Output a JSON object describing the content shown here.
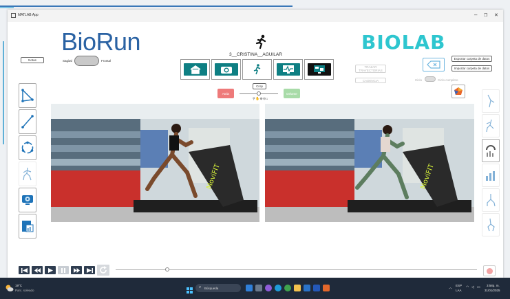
{
  "window": {
    "title": "MATLAB App",
    "controls": [
      "–",
      "❐",
      "✕"
    ]
  },
  "header": {
    "logo_left": "BioRun",
    "logo_right": "BIOLAB",
    "subject_name": "3__CRISTINA__AGUILAR",
    "notes_button": "Notas",
    "view_toggle": {
      "left_label": "Sagital",
      "right_label": "Frontal"
    }
  },
  "nav_icons": [
    {
      "name": "home-icon"
    },
    {
      "name": "camera-icon"
    },
    {
      "name": "runner-icon"
    },
    {
      "name": "monitor-chart-icon"
    },
    {
      "name": "monitor-report-icon"
    }
  ],
  "playback_side": {
    "left_button": "Atrás",
    "right_button": "Delante",
    "crop_label": "Crop"
  },
  "right_panel": {
    "trazar_trayectorias": "TRAZAR TRAYECTORIAS",
    "cadencia": "CADENCIA",
    "exportar": "Exportar carpeta de datos",
    "importar": "Importar carpeta de datos",
    "ciclo_label": "Ciclo",
    "ciclo_completo": "Ciclo completo"
  },
  "taskbar": {
    "weather_temp": "19°C",
    "weather_desc": "Parc. soleado",
    "search_placeholder": "Búsqueda",
    "lang": "ESP",
    "lang_sub": "LAA",
    "time": "3:58p. m.",
    "date": "31/01/2025"
  },
  "colors": {
    "brand_blue": "#2a62a3",
    "brand_teal": "#2ec6cf",
    "nav_teal": "#0e7f83",
    "back_red": "#ee7a7a",
    "forward_green": "#a8dba8",
    "player_bg": "#2f3d50"
  }
}
